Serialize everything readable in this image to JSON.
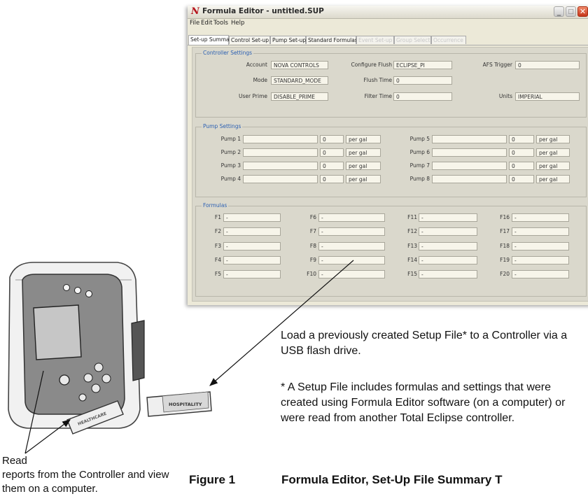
{
  "window": {
    "app_logo": "N",
    "title": "Formula Editor - untitled.SUP",
    "buttons": {
      "minimize": "_",
      "maximize": "□",
      "close": "✕"
    }
  },
  "menu": [
    "File",
    "Edit",
    "Tools",
    "Help"
  ],
  "tabs": [
    {
      "label": "Set-up Summary",
      "active": true,
      "enabled": true
    },
    {
      "label": "Control Set-up",
      "active": false,
      "enabled": true
    },
    {
      "label": "Pump Set-up",
      "active": false,
      "enabled": true
    },
    {
      "label": "Standard Formulas",
      "active": false,
      "enabled": true
    },
    {
      "label": "Event Set-up",
      "active": false,
      "enabled": false
    },
    {
      "label": "Group Select",
      "active": false,
      "enabled": false
    },
    {
      "label": "Occurrence",
      "active": false,
      "enabled": false
    }
  ],
  "controller": {
    "title": "Controller Settings",
    "account_label": "Account",
    "account_value": "NOVA CONTROLS",
    "mode_label": "Mode",
    "mode_value": "STANDARD_MODE",
    "prime_label": "User Prime",
    "prime_value": "DISABLE_PRIME",
    "flush_cfg_label": "Configure Flush",
    "flush_cfg_value": "ECLIPSE_PI",
    "flush_time_label": "Flush Time",
    "flush_time_value": "0",
    "filter_label": "Filter Time",
    "filter_value": "0",
    "afs_label": "AFS Trigger",
    "afs_value": "0",
    "units_label": "Units",
    "units_value": "IMPERIAL"
  },
  "pumps": {
    "title": "Pump Settings",
    "items": [
      {
        "label": "Pump 1",
        "name": "",
        "value": "0",
        "unit": "per gal"
      },
      {
        "label": "Pump 2",
        "name": "",
        "value": "0",
        "unit": "per gal"
      },
      {
        "label": "Pump 3",
        "name": "",
        "value": "0",
        "unit": "per gal"
      },
      {
        "label": "Pump 4",
        "name": "",
        "value": "0",
        "unit": "per gal"
      },
      {
        "label": "Pump 5",
        "name": "",
        "value": "0",
        "unit": "per gal"
      },
      {
        "label": "Pump 6",
        "name": "",
        "value": "0",
        "unit": "per gal"
      },
      {
        "label": "Pump 7",
        "name": "",
        "value": "0",
        "unit": "per gal"
      },
      {
        "label": "Pump 8",
        "name": "",
        "value": "0",
        "unit": "per gal"
      }
    ]
  },
  "formulas": {
    "title": "Formulas",
    "items": [
      {
        "label": "F1",
        "value": "-"
      },
      {
        "label": "F2",
        "value": "-"
      },
      {
        "label": "F3",
        "value": "-"
      },
      {
        "label": "F4",
        "value": "-"
      },
      {
        "label": "F5",
        "value": "-"
      },
      {
        "label": "F6",
        "value": "-"
      },
      {
        "label": "F7",
        "value": "-"
      },
      {
        "label": "F8",
        "value": "-"
      },
      {
        "label": "F9",
        "value": "-"
      },
      {
        "label": "F10",
        "value": "-"
      },
      {
        "label": "F11",
        "value": "-"
      },
      {
        "label": "F12",
        "value": "-"
      },
      {
        "label": "F13",
        "value": "-"
      },
      {
        "label": "F14",
        "value": "-"
      },
      {
        "label": "F15",
        "value": "-"
      },
      {
        "label": "F16",
        "value": "-"
      },
      {
        "label": "F17",
        "value": "-"
      },
      {
        "label": "F18",
        "value": "-"
      },
      {
        "label": "F19",
        "value": "-"
      },
      {
        "label": "F20",
        "value": "-"
      }
    ]
  },
  "illustration": {
    "usb_label_large": "HOSPITALITY",
    "usb_label_small": "HEALTHCARE"
  },
  "notes": {
    "load": "Load a previously created Setup File* to a Controller via a USB flash drive.",
    "setup": "* A Setup File includes formulas and settings that were created using Formula Editor software (on a computer) or were read from another Total Eclipse controller.",
    "read_1": "Read",
    "read_2": "reports from the Controller and view them on a computer."
  },
  "figure": {
    "label": "Figure 1",
    "title": "Formula Editor, Set-Up File Summary T"
  }
}
